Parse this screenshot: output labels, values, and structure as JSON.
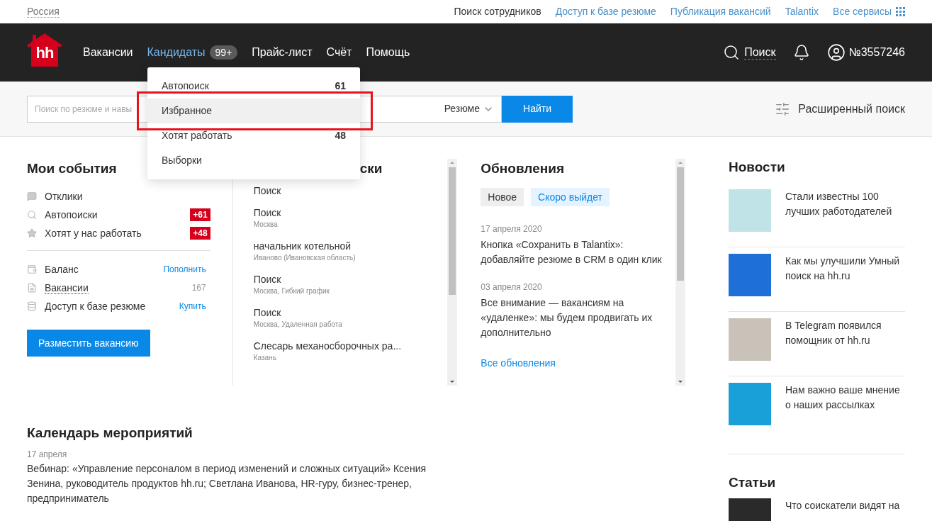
{
  "top_bar": {
    "region": "Россия",
    "links": [
      {
        "label": "Поиск сотрудников",
        "selected": true
      },
      {
        "label": "Доступ к базе резюме",
        "selected": false
      },
      {
        "label": "Публикация вакансий",
        "selected": false
      },
      {
        "label": "Talantix",
        "selected": false
      },
      {
        "label": "Все сервисы",
        "selected": false
      }
    ]
  },
  "header": {
    "logo": "hh",
    "nav": [
      {
        "label": "Вакансии",
        "selected": false
      },
      {
        "label": "Кандидаты",
        "selected": true,
        "badge": "99+"
      },
      {
        "label": "Прайс-лист",
        "selected": false
      },
      {
        "label": "Счёт",
        "selected": false
      },
      {
        "label": "Помощь",
        "selected": false
      }
    ],
    "search": "Поиск",
    "account": "№3557246"
  },
  "dropdown": {
    "items": [
      {
        "label": "Автопоиск",
        "count": "61",
        "selected": false,
        "annotated": false
      },
      {
        "label": "Избранное",
        "selected": true,
        "annotated": true
      },
      {
        "label": "Хотят работать",
        "count": "48",
        "selected": false,
        "annotated": false
      },
      {
        "label": "Выборки",
        "selected": false,
        "annotated": false
      }
    ]
  },
  "search_bar": {
    "placeholder": "Поиск по резюме и навы",
    "type": "Резюме",
    "button": "Найти",
    "advanced": "Расширенный поиск"
  },
  "events": {
    "title": "Мои события",
    "groups": [
      [
        {
          "label": "Отклики"
        },
        {
          "label": "Автопоиски",
          "badge": "+61"
        },
        {
          "label": "Хотят у нас работать",
          "badge": "+48"
        }
      ],
      [
        {
          "label": "Баланс",
          "action": "Пополнить"
        },
        {
          "label": "Вакансии",
          "value": "167"
        },
        {
          "label": "Доступ к базе резюме",
          "action": "Купить"
        }
      ]
    ],
    "button": "Разместить вакансию"
  },
  "searches": {
    "title": "ски",
    "items": [
      {
        "name": "Поиск"
      },
      {
        "name": "Поиск",
        "location": "Москва"
      },
      {
        "name": "начальник котельной",
        "location": "Иваново (Ивановская область)"
      },
      {
        "name": "Поиск",
        "location": "Москва, Гибкий график"
      },
      {
        "name": "Поиск",
        "location": "Москва, Удаленная работа"
      },
      {
        "name": "Слесарь механосборочных ра...",
        "location": "Казань"
      }
    ]
  },
  "updates": {
    "title": "Обновления",
    "tabs": [
      {
        "label": "Новое",
        "selected": false
      },
      {
        "label": "Скоро выйдет",
        "selected": true
      }
    ],
    "items": [
      {
        "date": "17 апреля 2020",
        "text": "Кнопка «Сохранить в Talantix»: добавляйте резюме в CRM в один клик"
      },
      {
        "date": "03 апреля 2020",
        "text": "Все внимание — вакансиям на «удаленке»: мы будем продвигать их дополнительно"
      }
    ],
    "link": "Все обновления"
  },
  "calendar": {
    "title": "Календарь мероприятий",
    "events": [
      {
        "date": "17 апреля",
        "text": "Вебинар: «Управление персоналом в период изменений и сложных ситуаций» Ксения Зенина, руководитель продуктов hh.ru; Светлана Иванова, HR-гуру, бизнес-тренер, предприниматель"
      }
    ]
  },
  "news": {
    "title": "Новости",
    "items": [
      {
        "text": "Стали известны 100 лучших работодателей"
      },
      {
        "text": "Как мы улучшили Умный поиск на hh.ru"
      },
      {
        "text": "В Telegram появился помощник от hh.ru"
      },
      {
        "text": "Нам важно ваше мнение о наших рассылках"
      }
    ]
  },
  "articles": {
    "title": "Статьи",
    "items": [
      {
        "text": "Что соискатели видят на"
      }
    ]
  }
}
